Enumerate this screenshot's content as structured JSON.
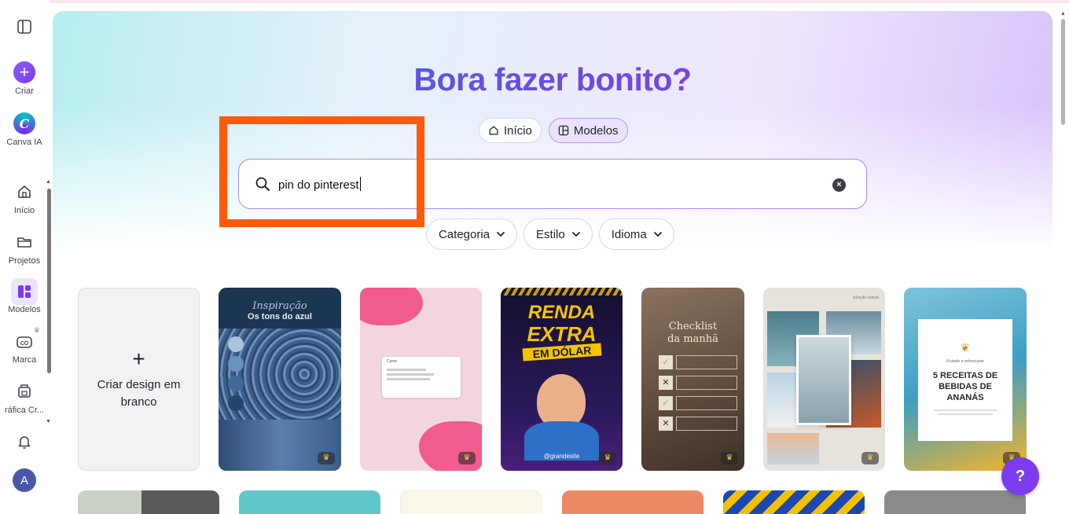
{
  "sidebar": {
    "items": [
      {
        "label": "Criar",
        "icon": "plus-icon"
      },
      {
        "label": "Canva IA",
        "icon": "canva-ai-icon"
      },
      {
        "label": "Início",
        "icon": "home-icon"
      },
      {
        "label": "Projetos",
        "icon": "folder-icon"
      },
      {
        "label": "Modelos",
        "icon": "templates-icon"
      },
      {
        "label": "Marca",
        "icon": "brand-icon"
      },
      {
        "label": "ráfica Cr...",
        "icon": "print-icon"
      }
    ],
    "avatar_initial": "A",
    "active_item": "Modelos"
  },
  "hero": {
    "title": "Bora fazer bonito?",
    "tabs": [
      {
        "label": "Início",
        "icon": "home-icon"
      },
      {
        "label": "Modelos",
        "icon": "templates-icon",
        "selected": true
      }
    ]
  },
  "search": {
    "value": "pin do pinterest",
    "placeholder": ""
  },
  "filters": [
    {
      "label": "Categoria"
    },
    {
      "label": "Estilo"
    },
    {
      "label": "Idioma"
    }
  ],
  "blank_card": {
    "plus": "+",
    "label": "Criar design em branco"
  },
  "templates": [
    {
      "heading": "Inspiração",
      "sub": "Os tons do azul"
    },
    {
      "search_caption": "Como"
    },
    {
      "line1": "RENDA",
      "line2": "EXTRA",
      "line3": "EM DÓLAR",
      "handle": "@grandesite"
    },
    {
      "heading": "Checklist",
      "sub": "da manhã"
    },
    {
      "caption": "coleção casual"
    },
    {
      "top": "Frutado e refrescante",
      "heading": "5 RECEITAS DE BEBIDAS DE ANANÁS"
    }
  ],
  "help": {
    "label": "?"
  },
  "colors": {
    "accent": "#7d3cf0",
    "highlight": "#ff5a0a"
  }
}
